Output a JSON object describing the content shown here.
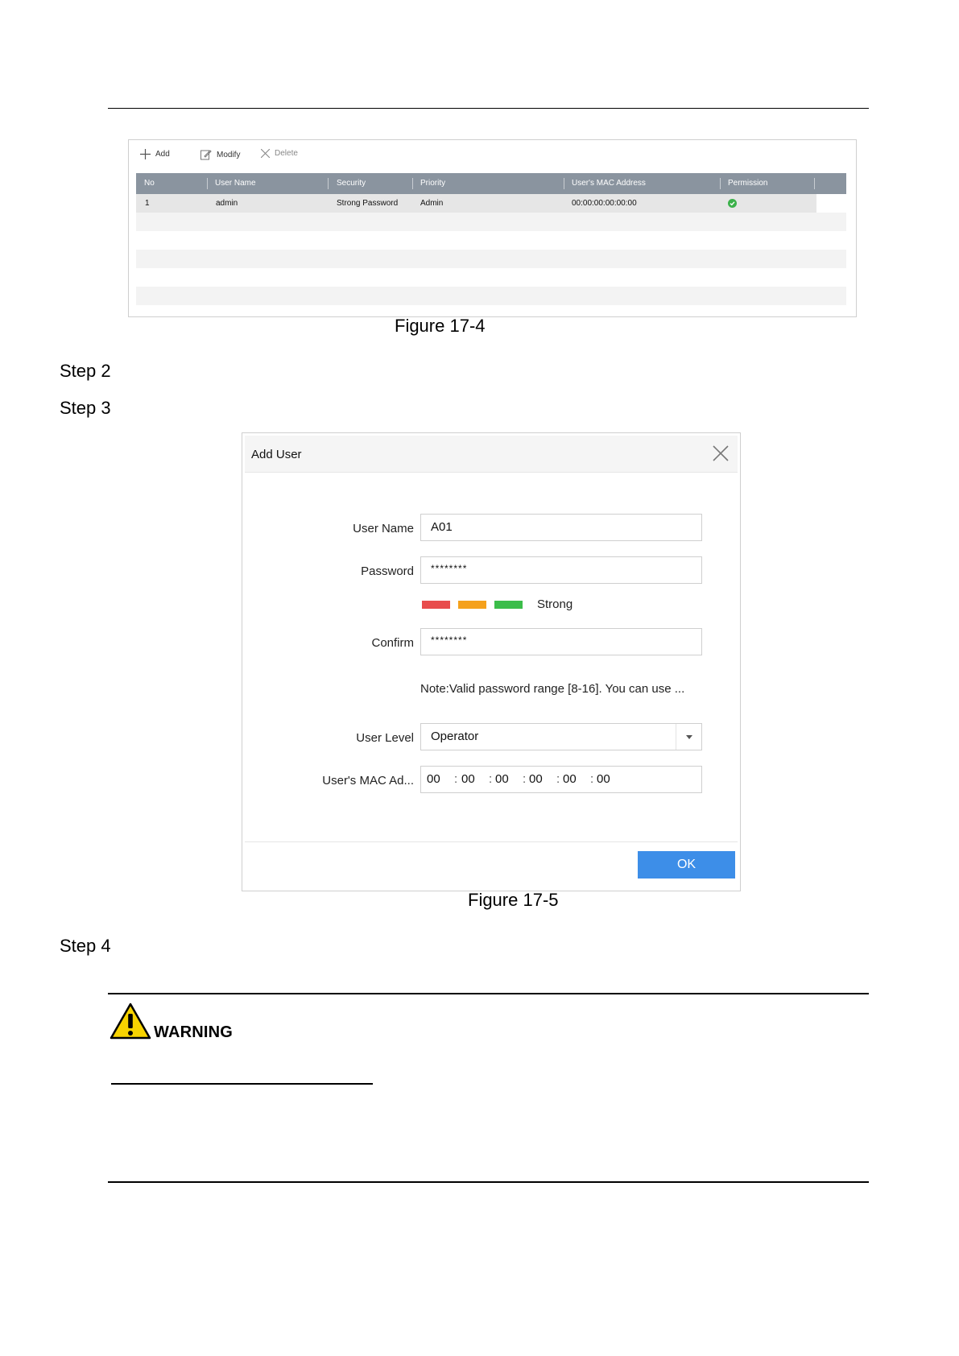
{
  "figure1": {
    "caption": "Figure 17-4",
    "toolbar": {
      "add": "Add",
      "modify": "Modify",
      "delete": "Delete"
    },
    "columns": [
      "No",
      "User Name",
      "Security",
      "Priority",
      "User's MAC Address",
      "Permission"
    ],
    "rows": [
      {
        "no": "1",
        "user_name": "admin",
        "security": "Strong Password",
        "priority": "Admin",
        "mac": "00:00:00:00:00:00",
        "permission_icon": "check-circle-icon"
      }
    ]
  },
  "steps": {
    "step2": "Step 2",
    "step3": "Step 3",
    "step4": "Step 4"
  },
  "figure2": {
    "caption": "Figure 17-5",
    "title": "Add User",
    "fields": {
      "user_name_label": "User Name",
      "user_name_value": "A01",
      "password_label": "Password",
      "password_value": "********",
      "strength_label": "Strong",
      "confirm_label": "Confirm",
      "confirm_value": "********",
      "note": "Note:Valid password range [8-16]. You can use ...",
      "user_level_label": "User Level",
      "user_level_value": "Operator",
      "mac_label": "User's MAC Ad...",
      "mac_parts": [
        "00",
        "00",
        "00",
        "00",
        "00",
        "00"
      ]
    },
    "strength_colors": [
      "#e84c4c",
      "#f5a11c",
      "#3bbd4a"
    ],
    "ok_label": "OK"
  },
  "warning": {
    "label": "WARNING"
  }
}
